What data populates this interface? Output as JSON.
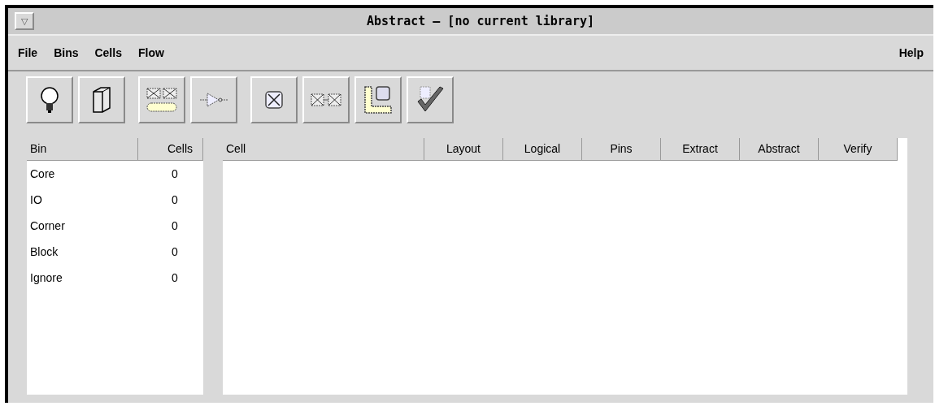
{
  "window": {
    "title": "Abstract – [no current library]",
    "menu_glyph": "▽"
  },
  "menu": {
    "left": [
      "File",
      "Bins",
      "Cells",
      "Flow"
    ],
    "right": [
      "Help"
    ]
  },
  "toolbar": [
    [
      {
        "kind": "bulb"
      },
      {
        "kind": "book"
      }
    ],
    [
      {
        "kind": "cellrow"
      },
      {
        "kind": "gate"
      }
    ],
    [
      {
        "kind": "cross"
      },
      {
        "kind": "crosspair"
      },
      {
        "kind": "corner"
      },
      {
        "kind": "check"
      }
    ]
  ],
  "bins": {
    "columns": [
      "Bin",
      "Cells"
    ],
    "rows": [
      [
        "Core",
        "0"
      ],
      [
        "IO",
        "0"
      ],
      [
        "Corner",
        "0"
      ],
      [
        "Block",
        "0"
      ],
      [
        "Ignore",
        "0"
      ]
    ]
  },
  "cells": {
    "columns": [
      "Cell",
      "Layout",
      "Logical",
      "Pins",
      "Extract",
      "Abstract",
      "Verify"
    ]
  }
}
